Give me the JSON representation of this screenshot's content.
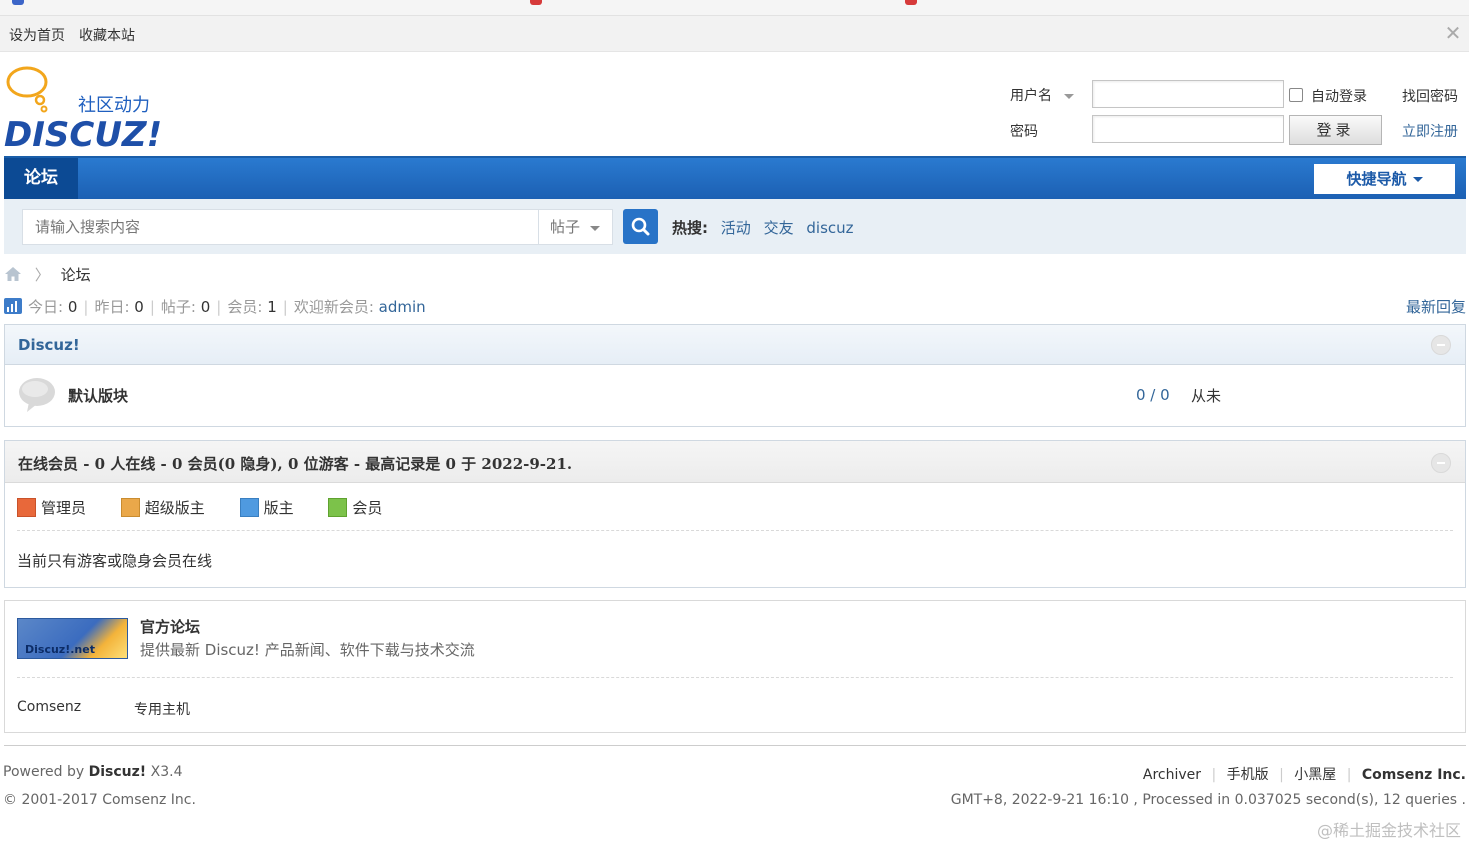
{
  "topbar": {
    "set_home": "设为首页",
    "bookmark": "收藏本站"
  },
  "logo": {
    "subtitle": "社区动力",
    "brand": "DISCUZ!"
  },
  "login": {
    "username_label": "用户名",
    "password_label": "密码",
    "auto_login": "自动登录",
    "forgot": "找回密码",
    "register": "立即注册",
    "login_button": "登录"
  },
  "nav": {
    "forum_tab": "论坛",
    "quick_nav": "快捷导航"
  },
  "search": {
    "placeholder": "请输入搜索内容",
    "type": "帖子",
    "hot_label": "热搜:",
    "hot_terms": [
      "活动",
      "交友",
      "discuz"
    ]
  },
  "breadcrumb": {
    "current": "论坛"
  },
  "stats": {
    "today_label": "今日:",
    "today": "0",
    "yesterday_label": "昨日:",
    "yesterday": "0",
    "posts_label": "帖子:",
    "posts": "0",
    "members_label": "会员:",
    "members": "1",
    "newest_label": "欢迎新会员:",
    "newest": "admin",
    "latest_replies": "最新回复"
  },
  "category": {
    "title": "Discuz!",
    "forums": [
      {
        "name": "默认版块",
        "counts": "0 / 0",
        "last_post": "从未"
      }
    ]
  },
  "online": {
    "title": "在线会员 - 0 人在线 - 0 会员(0 隐身), 0 位游客 - 最高记录是 0 于 2022-9-21.",
    "legend": [
      "管理员",
      "超级版主",
      "版主",
      "会员"
    ],
    "message": "当前只有游客或隐身会员在线",
    "legend_colors": [
      "#e8683a",
      "#eaa84a",
      "#4f9ae0",
      "#7cc24a"
    ]
  },
  "links": {
    "banner_text": "Discuz!.net",
    "title": "官方论坛",
    "desc": "提供最新 Discuz! 产品新闻、软件下载与技术交流",
    "text_links": [
      "Comsenz",
      "专用主机"
    ]
  },
  "footer": {
    "powered_prefix": "Powered by",
    "powered_brand": "Discuz!",
    "version": "X3.4",
    "copyright": "© 2001-2017 Comsenz Inc.",
    "right_links": [
      "Archiver",
      "手机版",
      "小黑屋"
    ],
    "company": "Comsenz Inc.",
    "processed": "GMT+8, 2022-9-21 16:10 , Processed in 0.037025 second(s), 12 queries ."
  },
  "watermark": "@稀土掘金技术社区"
}
